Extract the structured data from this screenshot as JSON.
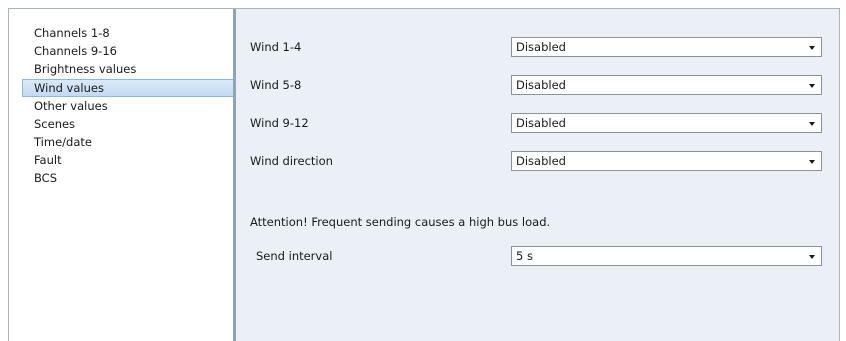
{
  "sidebar": {
    "items": [
      {
        "label": "Channels 1-8",
        "selected": false
      },
      {
        "label": "Channels 9-16",
        "selected": false
      },
      {
        "label": "Brightness values",
        "selected": false
      },
      {
        "label": "Wind values",
        "selected": true
      },
      {
        "label": "Other values",
        "selected": false
      },
      {
        "label": "Scenes",
        "selected": false
      },
      {
        "label": "Time/date",
        "selected": false
      },
      {
        "label": "Fault",
        "selected": false
      },
      {
        "label": "BCS",
        "selected": false
      }
    ]
  },
  "main": {
    "params": [
      {
        "label": "Wind 1-4",
        "value": "Disabled"
      },
      {
        "label": "Wind 5-8",
        "value": "Disabled"
      },
      {
        "label": "Wind 9-12",
        "value": "Disabled"
      },
      {
        "label": "Wind direction",
        "value": "Disabled"
      }
    ],
    "note": "Attention! Frequent sending causes a high bus load.",
    "send_interval": {
      "label": "Send interval",
      "value": "5 s"
    }
  },
  "colors": {
    "content_bg": "#eaf0f6",
    "selected_bg": "#c3daf1",
    "divider": "#8ea4b7"
  }
}
